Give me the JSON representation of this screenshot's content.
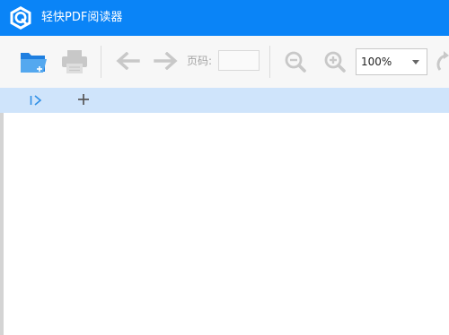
{
  "window": {
    "title": "轻快PDF阅读器",
    "logo_icon": "app-logo-q-hexagon",
    "titlebar_color": "#0a84f7"
  },
  "toolbar": {
    "open_icon": "folder-open-plus-icon",
    "print_icon": "printer-icon",
    "prev_icon": "arrow-left-icon",
    "next_icon": "arrow-right-icon",
    "page_label": "页码:",
    "page_value": "",
    "zoom_out_icon": "zoom-out-icon",
    "zoom_in_icon": "zoom-in-icon",
    "zoom_value": "100%",
    "rotate_icon": "rotate-icon"
  },
  "tabbar": {
    "sidebar_toggle_icon": "sidebar-expand-icon",
    "new_tab_icon": "plus-icon"
  },
  "colors": {
    "accent": "#0a84f7",
    "tabbar_bg": "#cfe4fb",
    "toolbar_bg": "#f7f7f7",
    "disabled_icon": "#c8c8c8"
  }
}
